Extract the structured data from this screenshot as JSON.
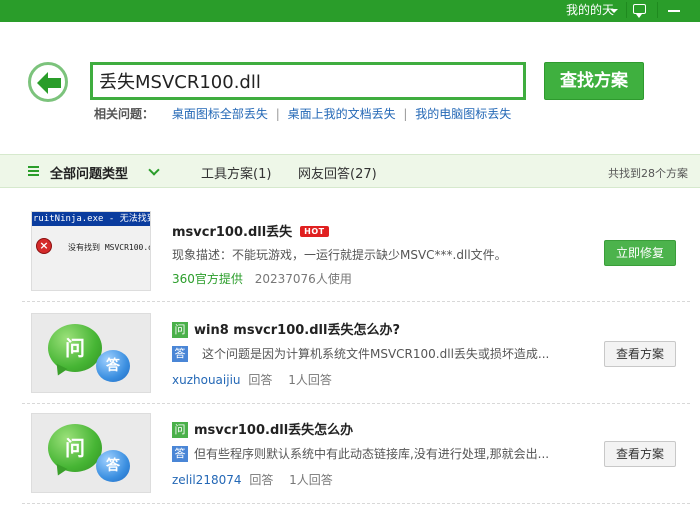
{
  "topbar": {
    "user": "我的的天"
  },
  "search": {
    "query": "丢失MSVCR100.dll",
    "button": "查找方案"
  },
  "related": {
    "label": "相关问题：",
    "links": [
      "桌面图标全部丢失",
      "桌面上我的文档丢失",
      "我的电脑图标丢失"
    ]
  },
  "filter": {
    "all_types": "全部问题类型",
    "tabs": [
      "工具方案(1)",
      "网友回答(27)"
    ],
    "found": "共找到28个方案"
  },
  "results": [
    {
      "title": "msvcr100.dll丢失",
      "badge": "HOT",
      "desc": "现象描述：不能玩游戏，一运行就提示缺少MSVC***.dll文件。",
      "provider": "360官方提供",
      "users": "20237076人使用",
      "button": "立即修复",
      "thumb_title": "ruitNinja.exe - 无法找到",
      "thumb_text": "没有找到 MSVCR100.dll"
    },
    {
      "q_badge": "问",
      "title": "win8 msvcr100.dll丢失怎么办?",
      "a_badge": "答",
      "desc": "这个问题是因为计算机系统文件MSVCR100.dll丢失或损坏造成...",
      "user": "xuzhouaijiu",
      "answer_label": "回答",
      "answers": "1人回答",
      "button": "查看方案",
      "illus_q": "问",
      "illus_a": "答"
    },
    {
      "q_badge": "问",
      "title": "msvcr100.dll丢失怎么办",
      "a_badge": "答",
      "desc": "但有些程序则默认系统中有此动态链接库,没有进行处理,那就会出...",
      "user": "zelil218074",
      "answer_label": "回答",
      "answers": "1人回答",
      "button": "查看方案",
      "illus_q": "问",
      "illus_a": "答"
    }
  ]
}
